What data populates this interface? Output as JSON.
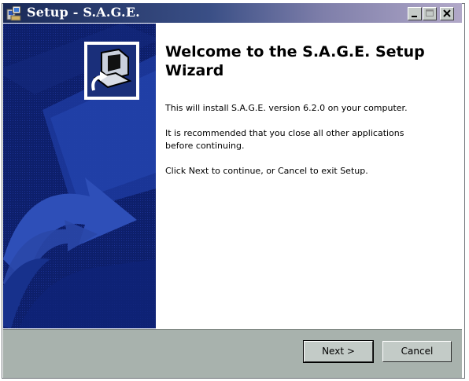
{
  "window": {
    "title": "Setup - S.A.G.E."
  },
  "heading": "Welcome to the S.A.G.E. Setup Wizard",
  "paragraphs": [
    "This will install S.A.G.E. version 6.2.0 on your computer.",
    "It is recommended that you close all other applications before continuing.",
    "Click Next to continue, or Cancel to exit Setup."
  ],
  "buttons": {
    "next": "Next >",
    "cancel": "Cancel"
  },
  "icons": {
    "title": "setup-app-icon",
    "logo": "computer-install-icon"
  },
  "colors": {
    "sidebar": "#0d1f6b",
    "footer": "#a8b2ad",
    "titlebar_start": "#1a2a58",
    "titlebar_end": "#b1a8c8"
  }
}
